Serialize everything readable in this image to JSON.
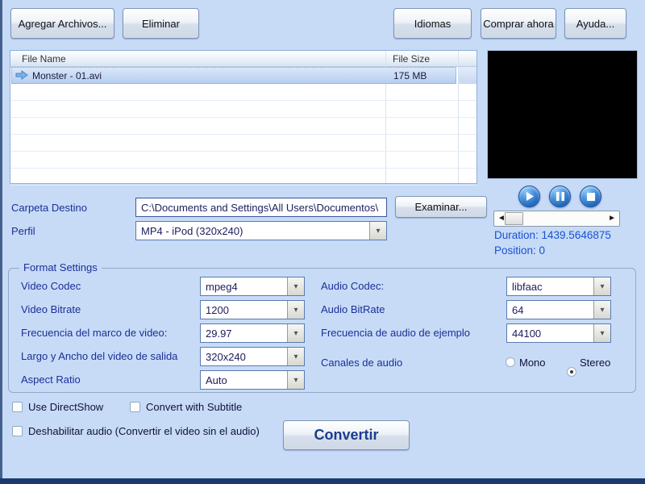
{
  "toolbar": {
    "add_files": "Agregar Archivos...",
    "remove": "Eliminar",
    "languages": "Idiomas",
    "buy_now": "Comprar ahora",
    "help": "Ayuda..."
  },
  "file_list": {
    "columns": [
      "File Name",
      "File Size"
    ],
    "rows": [
      {
        "name": "Monster - 01.avi",
        "size": "175 MB",
        "selected": true
      }
    ]
  },
  "player": {
    "duration": "Duration: 1439.5646875",
    "position": "Position: 0"
  },
  "output": {
    "folder_label": "Carpeta Destino",
    "folder_path": "C:\\Documents and Settings\\All Users\\Documentos\\",
    "browse": "Examinar...",
    "profile_label": "Perfil",
    "profile_value": "MP4 - iPod (320x240)"
  },
  "format": {
    "title": "Format Settings",
    "left": [
      {
        "label": "Video Codec",
        "value": "mpeg4"
      },
      {
        "label": "Video Bitrate",
        "value": "1200"
      },
      {
        "label": "Frecuencia del marco de video:",
        "value": "29.97"
      },
      {
        "label": "Largo y Ancho del video de salida",
        "value": "320x240"
      },
      {
        "label": "Aspect Ratio",
        "value": "Auto"
      }
    ],
    "right": [
      {
        "label": "Audio Codec:",
        "value": "libfaac"
      },
      {
        "label": "Audio BitRate",
        "value": "64"
      },
      {
        "label": "Frecuencia de audio de ejemplo",
        "value": "44100"
      }
    ],
    "channels": {
      "label": "Canales de audio",
      "mono": "Mono",
      "stereo": "Stereo",
      "selected": "Stereo"
    }
  },
  "options": {
    "use_directshow": "Use DirectShow",
    "convert_with_subtitle": "Convert with Subtitle",
    "disable_audio": "Deshabilitar audio (Convertir el video sin el audio)"
  },
  "convert": {
    "label": "Convertir"
  }
}
